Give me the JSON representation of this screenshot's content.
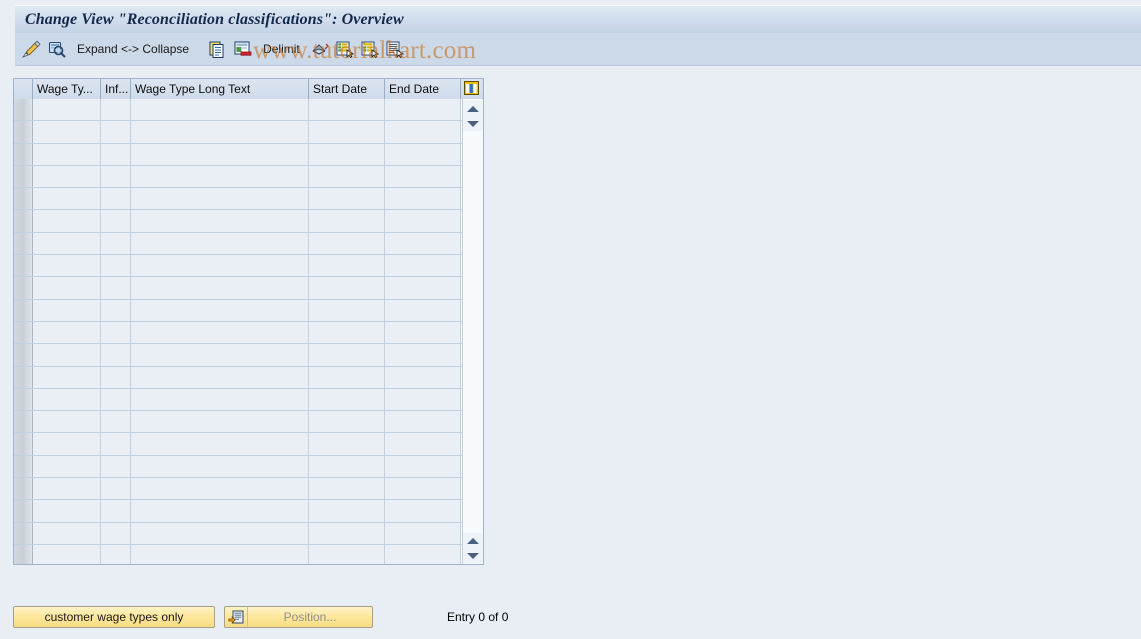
{
  "window": {
    "title": "Change View \"Reconciliation classifications\": Overview"
  },
  "watermark": {
    "text": "www.tutorialkart.com"
  },
  "toolbar": {
    "items": [
      {
        "name": "display-change-icon",
        "icon": "pencil-magnifier",
        "label": ""
      },
      {
        "name": "check-entries-icon",
        "icon": "magnifier-check",
        "label": ""
      },
      {
        "name": "expand-collapse-button",
        "icon": "",
        "label": "Expand <-> Collapse"
      },
      {
        "name": "copy-as-icon",
        "icon": "copy-pages",
        "label": ""
      },
      {
        "name": "delete-icon",
        "icon": "delete-row",
        "label": ""
      },
      {
        "name": "delimit-button",
        "icon": "",
        "label": "Delimit"
      },
      {
        "name": "undo-icon",
        "icon": "undo-arrow",
        "label": ""
      },
      {
        "name": "select-all-icon",
        "icon": "select-all",
        "label": ""
      },
      {
        "name": "deselect-all-icon",
        "icon": "deselect-all",
        "label": ""
      },
      {
        "name": "print-preview-icon",
        "icon": "print-preview",
        "label": ""
      }
    ]
  },
  "table": {
    "columns": [
      {
        "key": "selector",
        "label": ""
      },
      {
        "key": "wage_type",
        "label": "Wage Ty..."
      },
      {
        "key": "inf",
        "label": "Inf..."
      },
      {
        "key": "wage_type_long_text",
        "label": "Wage Type Long Text"
      },
      {
        "key": "start_date",
        "label": "Start Date"
      },
      {
        "key": "end_date",
        "label": "End Date"
      }
    ],
    "config_icon": "table-settings-icon",
    "rows": [],
    "empty_row_count": 21,
    "scroll": {
      "up_arrow": "scroll-up-arrow",
      "down_arrow": "scroll-down-arrow"
    }
  },
  "footer": {
    "customer_wage_types_label": "customer wage types only",
    "position_label": "Position...",
    "position_icon": "position-icon",
    "entry_status": "Entry 0 of 0"
  },
  "colors": {
    "page_background": "#e9eef4",
    "title_bar": "#cfdced",
    "toolbar": "#ccd9e8",
    "table_header": "#cfdbea",
    "table_cell": "#eaeff6",
    "button_yellow": "#fce79b",
    "watermark": "#c7701e"
  }
}
